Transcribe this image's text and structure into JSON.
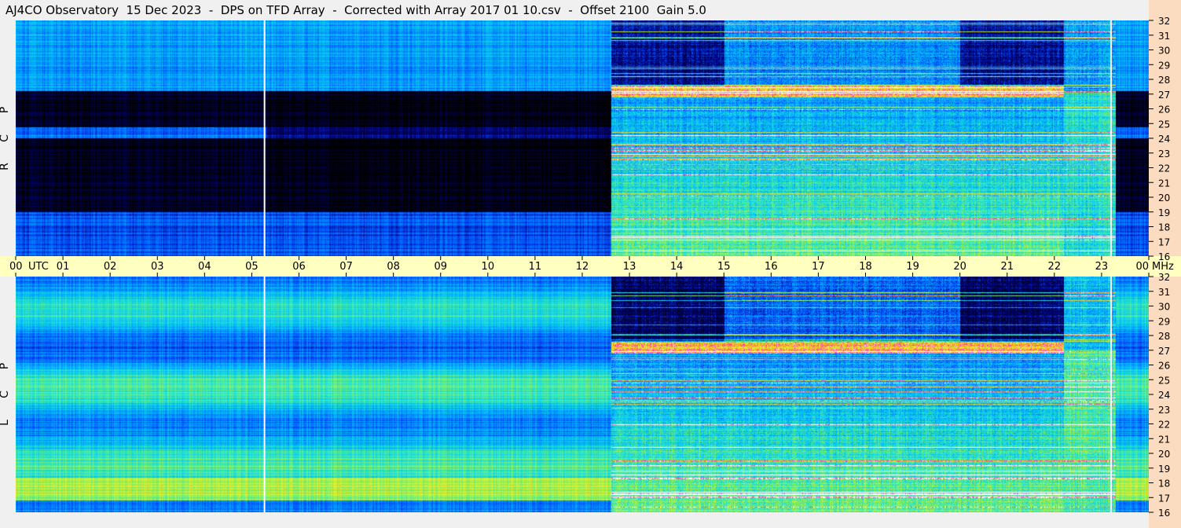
{
  "title": "AJ4CO Observatory  15 Dec 2023  -  DPS on TFD Array  -  Corrected with Array 2017 01 10.csv  -  Offset 2100  Gain 5.0",
  "colors": {
    "background": "#f0f0f0",
    "time_axis_bg": "#ffffc0",
    "freq_axis_bg": "#fbdcc0",
    "text": "#000000"
  },
  "chart_data": [
    {
      "type": "heatmap",
      "panel": "top",
      "side_label": [
        "R",
        "C",
        "P"
      ],
      "x_unit": "UTC hour",
      "x_range": [
        0,
        24
      ],
      "y_unit": "MHz",
      "y_range": [
        16,
        32
      ],
      "y_ticks": [
        "32",
        "31",
        "30",
        "29",
        "28",
        "27",
        "26",
        "25",
        "24",
        "23",
        "22",
        "21",
        "20",
        "19",
        "18",
        "17",
        "16"
      ],
      "colormap": [
        "black",
        "blue",
        "cyan",
        "green",
        "yellow",
        "red",
        "magenta",
        "white"
      ]
    },
    {
      "type": "heatmap",
      "panel": "bottom",
      "side_label": [
        "L",
        "C",
        "P"
      ],
      "x_unit": "UTC hour",
      "x_range": [
        0,
        24
      ],
      "y_unit": "MHz",
      "y_range": [
        16,
        32
      ],
      "y_ticks": [
        "32",
        "31",
        "30",
        "29",
        "28",
        "27",
        "26",
        "25",
        "24",
        "23",
        "22",
        "21",
        "20",
        "19",
        "18",
        "17",
        "16"
      ],
      "colormap": [
        "black",
        "blue",
        "cyan",
        "green",
        "yellow",
        "red",
        "magenta",
        "white"
      ]
    }
  ],
  "time_axis": {
    "ticks": [
      "00",
      "01",
      "02",
      "03",
      "04",
      "05",
      "06",
      "07",
      "08",
      "09",
      "10",
      "11",
      "12",
      "13",
      "14",
      "15",
      "16",
      "17",
      "18",
      "19",
      "20",
      "21",
      "22",
      "23",
      "00"
    ],
    "utc_label": "UTC",
    "mhz_label": "MHz"
  }
}
